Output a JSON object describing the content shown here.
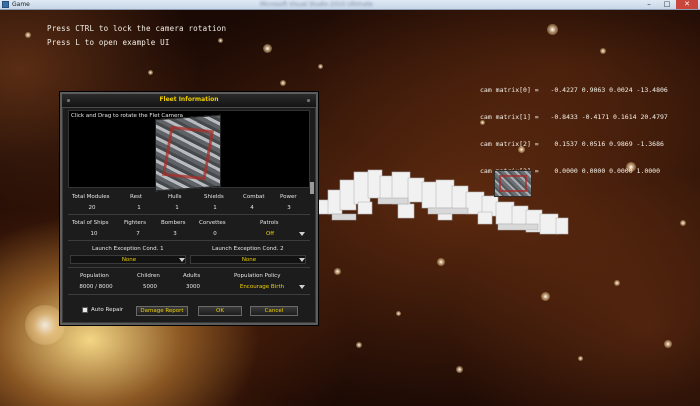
{
  "window": {
    "title": "Game",
    "title_blurred": "Microsoft Visual Studio 2010 Ultimate",
    "buttons": {
      "minimize": "–",
      "maximize": "□",
      "close": "✕"
    }
  },
  "hints": {
    "line1": "Press CTRL to lock the camera rotation",
    "line2": "Press L to open example UI"
  },
  "cam_matrix": {
    "row0": "cam matrix[0] =   -0.4227 0.9063 0.0024 -13.4806",
    "row1": "cam matrix[1] =   -0.8433 -0.4171 0.1614 20.4797",
    "row2": "cam matrix[2] =    0.1537 0.0516 0.9869 -1.3686",
    "row3": "cam matrix[3] =    0.0000 0.0000 0.0000 1.0000"
  },
  "fleet_dialog": {
    "title": "Fleet Information",
    "preview_hint": "Click and Drag to rotate the Flet Camera",
    "modules": {
      "headers": [
        "Total Modules",
        "Rest",
        "Hulls",
        "Shields",
        "Combat",
        "Power"
      ],
      "values": [
        "20",
        "1",
        "1",
        "1",
        "4",
        "3"
      ]
    },
    "ships": {
      "headers": [
        "Total of Ships",
        "Fighters",
        "Bombers",
        "Corvettes",
        "Patrols"
      ],
      "values": [
        "10",
        "7",
        "3",
        "0",
        "Off"
      ]
    },
    "launch": {
      "cond1_label": "Launch Exception Cond. 1",
      "cond2_label": "Launch Exception Cond. 2",
      "cond1_value": "None",
      "cond2_value": "None"
    },
    "population": {
      "headers": [
        "Population",
        "Children",
        "Adults",
        "Population Policy"
      ],
      "values": [
        "8000 / 8000",
        "5000",
        "3000",
        "Encourage Birth"
      ]
    },
    "footer": {
      "auto_repair_label": "Auto Repair",
      "damage_report_label": "Damage Report",
      "ok_label": "OK",
      "cancel_label": "Cancel"
    }
  }
}
